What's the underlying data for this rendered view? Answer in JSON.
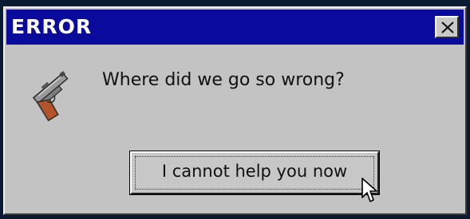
{
  "dialog": {
    "title": "ERROR",
    "message": "Where did we go so wrong?",
    "button_label": "I cannot help you now",
    "icon": "gun-icon",
    "close_icon": "close-icon",
    "colors": {
      "titlebar": "#0a0a9c",
      "body": "#c3c3c3",
      "title_text": "#ffffff"
    }
  }
}
